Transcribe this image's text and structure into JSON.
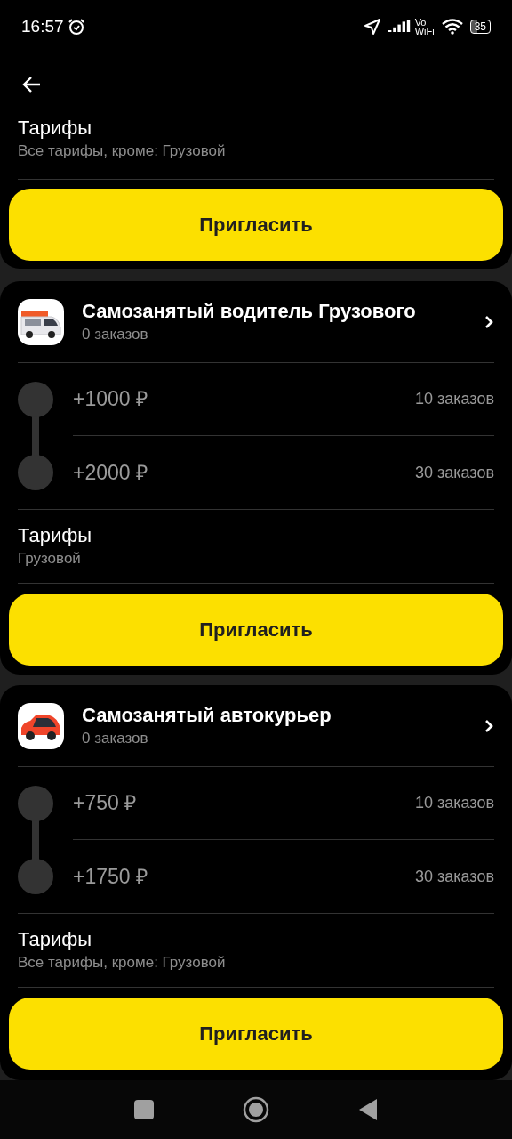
{
  "status_bar": {
    "time": "16:57",
    "vowifi_top": "Vo",
    "vowifi_bottom": "WiFi",
    "battery": "35"
  },
  "top_card": {
    "tariffs_title": "Тарифы",
    "tariffs_value": "Все тарифы, кроме: Грузовой",
    "button": "Пригласить"
  },
  "offers": [
    {
      "kind": "truck",
      "title": "Самозанятый водитель Грузового",
      "subtitle": "0 заказов",
      "tiers": [
        {
          "bonus": "+1000 ₽",
          "orders": "10 заказов"
        },
        {
          "bonus": "+2000 ₽",
          "orders": "30 заказов"
        }
      ],
      "tariffs_title": "Тарифы",
      "tariffs_value": "Грузовой",
      "button": "Пригласить"
    },
    {
      "kind": "car",
      "title": "Самозанятый автокурьер",
      "subtitle": "0 заказов",
      "tiers": [
        {
          "bonus": "+750 ₽",
          "orders": "10 заказов"
        },
        {
          "bonus": "+1750 ₽",
          "orders": "30 заказов"
        }
      ],
      "tariffs_title": "Тарифы",
      "tariffs_value": "Все тарифы, кроме: Грузовой",
      "button": "Пригласить"
    }
  ]
}
